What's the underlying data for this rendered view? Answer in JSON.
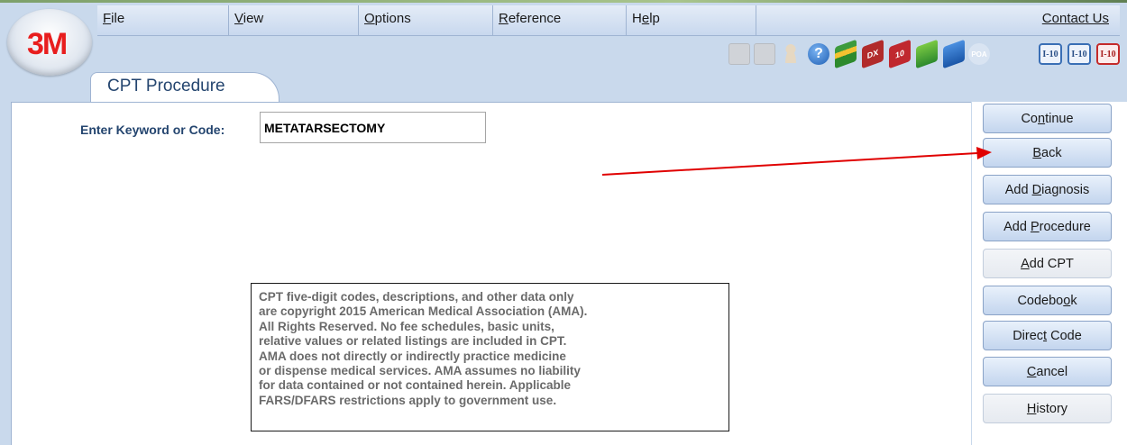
{
  "menu": {
    "file": {
      "u": "F",
      "rest": "ile"
    },
    "view": {
      "u": "V",
      "rest": "iew"
    },
    "options": {
      "u": "O",
      "rest": "ptions"
    },
    "reference": {
      "u": "R",
      "rest": "eference"
    },
    "help": {
      "pre": "H",
      "u": "e",
      "rest": "lp"
    },
    "contact": "Contact Us"
  },
  "logo": {
    "text": "3M"
  },
  "toolbar": {
    "icons": [
      "printer-icon",
      "print-add-icon",
      "user-icon",
      "help-icon",
      "book-icon",
      "dx-book-icon",
      "icd10-book-icon",
      "green-book-icon",
      "blue-book-icon",
      "poa-icon",
      "i10-icon",
      "i10-search-icon",
      "i10-red-icon"
    ],
    "dx_label": "DX",
    "ten_label": "10",
    "poa_label": "POA",
    "i10_label": "I-10"
  },
  "tab": {
    "label": "CPT Procedure"
  },
  "search": {
    "label": "Enter Keyword or Code:",
    "value": "METATARSECTOMY"
  },
  "copyright": {
    "lines": [
      "CPT five-digit codes, descriptions, and other data only",
      "are copyright 2015 American Medical Association (AMA).",
      "All Rights Reserved. No fee schedules, basic units,",
      "relative values or related listings are included in CPT.",
      "AMA does not directly or indirectly practice medicine",
      "or dispense medical services. AMA assumes no liability",
      "for data contained or not contained herein. Applicable",
      "FARS/DFARS restrictions apply to government use."
    ]
  },
  "buttons": {
    "continue": {
      "pre": "Co",
      "u": "n",
      "post": "tinue"
    },
    "back": {
      "pre": "",
      "u": "B",
      "post": "ack"
    },
    "add_diagnosis": {
      "pre": "Add ",
      "u": "D",
      "post": "iagnosis"
    },
    "add_procedure": {
      "pre": "Add ",
      "u": "P",
      "post": "rocedure"
    },
    "add_cpt": {
      "pre": "",
      "u": "A",
      "post": "dd CPT"
    },
    "codebook": {
      "pre": "Codebo",
      "u": "o",
      "post": "k"
    },
    "direct_code": {
      "pre": "Direc",
      "u": "t",
      "post": " Code"
    },
    "cancel": {
      "pre": "",
      "u": "C",
      "post": "ancel"
    },
    "history": {
      "pre": "",
      "u": "H",
      "post": "istory"
    }
  },
  "colors": {
    "accent": "#24456f",
    "arrow": "#e00000",
    "logo_red": "#e81e1e"
  }
}
